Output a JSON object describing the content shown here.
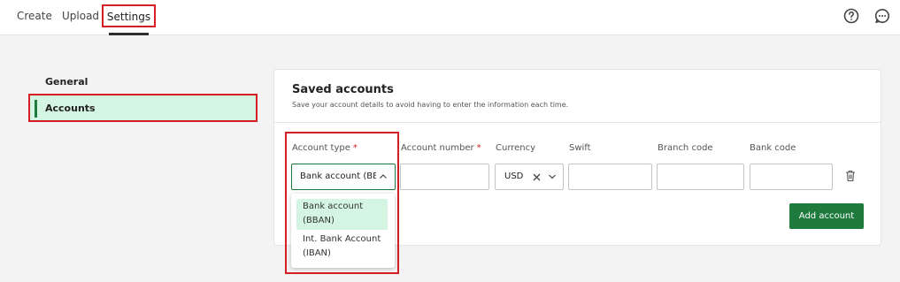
{
  "header": {
    "tabs": [
      {
        "label": "Create"
      },
      {
        "label": "Upload"
      },
      {
        "label": "Settings"
      }
    ],
    "active_tab": "Settings",
    "icons": [
      "help-icon",
      "chat-icon"
    ]
  },
  "sidebar": {
    "items": [
      {
        "label": "General"
      },
      {
        "label": "Accounts"
      }
    ],
    "active_item": "Accounts"
  },
  "card": {
    "title": "Saved accounts",
    "subtitle": "Save your account details to avoid having to enter the information each time.",
    "columns": {
      "account_type": "Account type",
      "account_number": "Account number",
      "currency": "Currency",
      "swift": "Swift",
      "branch_code": "Branch code",
      "bank_code": "Bank code"
    },
    "required_marker": "*",
    "values": {
      "account_type": "Bank account (BBAN)",
      "account_number": "",
      "currency": "USD",
      "swift": "",
      "branch_code": "",
      "bank_code": ""
    },
    "add_button": "Add account"
  },
  "dropdown": {
    "options": [
      {
        "label": "Bank account (BBAN)"
      },
      {
        "label": "Int. Bank Account (IBAN)"
      }
    ],
    "selected": "Bank account (BBAN)"
  },
  "colors": {
    "accent_green": "#1e7a3d",
    "highlight_green": "#d5f5e3",
    "annotation_red": "#d61c24"
  }
}
